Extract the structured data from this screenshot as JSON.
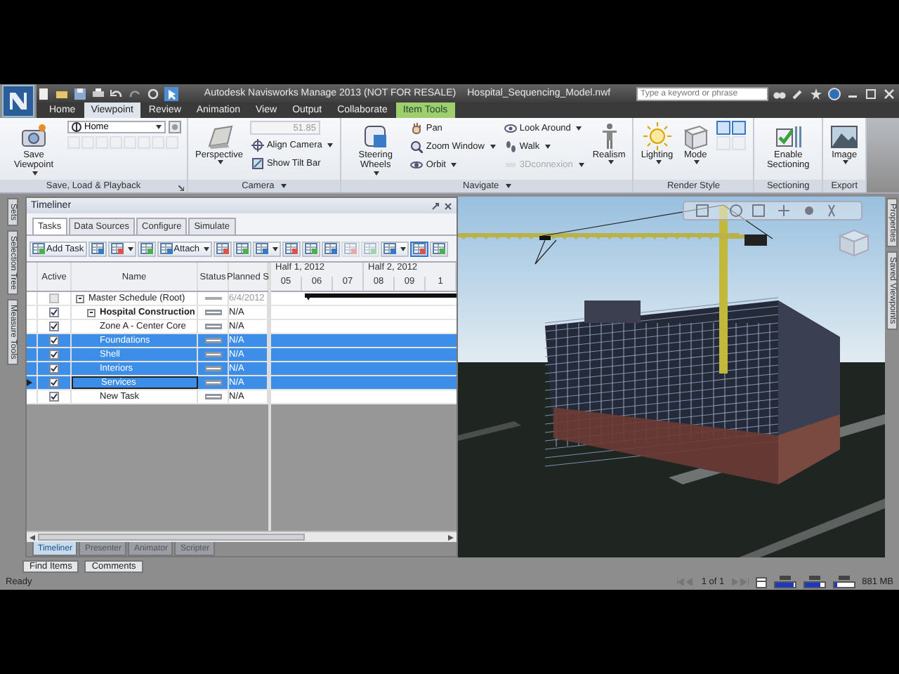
{
  "title_bar": {
    "title": "Autodesk Navisworks Manage 2013 (NOT FOR RESALE)",
    "file": "Hospital_Sequencing_Model.nwf",
    "search": {
      "placeholder": "Type a keyword or phrase"
    }
  },
  "ribbon_tabs": [
    {
      "label": "Home",
      "selected": false,
      "kind": "normal"
    },
    {
      "label": "Viewpoint",
      "selected": true,
      "kind": "normal"
    },
    {
      "label": "Review",
      "selected": false,
      "kind": "normal"
    },
    {
      "label": "Animation",
      "selected": false,
      "kind": "normal"
    },
    {
      "label": "View",
      "selected": false,
      "kind": "normal"
    },
    {
      "label": "Output",
      "selected": false,
      "kind": "normal"
    },
    {
      "label": "Collaborate",
      "selected": false,
      "kind": "normal"
    },
    {
      "label": "Item Tools",
      "selected": false,
      "kind": "contextual"
    }
  ],
  "ribbon_panels": [
    {
      "label": "Save, Load & Playback",
      "menu": false,
      "launcher": true,
      "columns": [
        [
          {
            "kind": "large",
            "label": "Save Viewpoint",
            "dropdown": true,
            "disabled": false
          }
        ],
        [
          {
            "kind": "select",
            "value": "Home"
          },
          {
            "kind": "buttons",
            "buttons": [
              {
                "selected": false,
                "disabled": true
              },
              {
                "selected": false,
                "disabled": true
              },
              {
                "selected": false,
                "disabled": true
              },
              {
                "selected": false,
                "disabled": true
              },
              {
                "selected": false,
                "disabled": true
              },
              {
                "selected": false,
                "disabled": true
              },
              {
                "selected": false,
                "disabled": true
              },
              {
                "selected": false,
                "disabled": true
              }
            ]
          }
        ]
      ]
    },
    {
      "label": "Camera",
      "menu": true,
      "launcher": false,
      "columns": [
        [
          {
            "kind": "large",
            "label": "Perspective",
            "dropdown": true,
            "disabled": false
          }
        ],
        [
          {
            "kind": "field",
            "value": "51.85",
            "disabled": true
          },
          {
            "kind": "small",
            "label": "Align Camera",
            "dropdown": true,
            "disabled": false
          },
          {
            "kind": "small",
            "label": "Show Tilt Bar",
            "dropdown": false,
            "disabled": false
          }
        ]
      ]
    },
    {
      "label": "Navigate",
      "menu": true,
      "launcher": false,
      "columns": [
        [
          {
            "kind": "large",
            "label": "Steering Wheels",
            "dropdown": true,
            "disabled": false
          }
        ],
        [
          {
            "kind": "small",
            "label": "Pan",
            "dropdown": false,
            "disabled": false
          },
          {
            "kind": "small",
            "label": "Zoom Window",
            "dropdown": true,
            "disabled": false
          },
          {
            "kind": "small",
            "label": "Orbit",
            "dropdown": true,
            "disabled": false
          }
        ],
        [
          {
            "kind": "small",
            "label": "Look Around",
            "dropdown": true,
            "disabled": false
          },
          {
            "kind": "small",
            "label": "Walk",
            "dropdown": true,
            "disabled": false
          },
          {
            "kind": "small",
            "label": "3Dconnexion",
            "dropdown": true,
            "disabled": true
          }
        ],
        [
          {
            "kind": "large",
            "label": "Realism",
            "dropdown": true,
            "disabled": false
          }
        ]
      ]
    },
    {
      "label": "Render Style",
      "menu": false,
      "launcher": false,
      "columns": [
        [
          {
            "kind": "large",
            "label": "Lighting",
            "dropdown": true,
            "disabled": false
          }
        ],
        [
          {
            "kind": "large",
            "label": "Mode",
            "dropdown": true,
            "disabled": false
          }
        ],
        [
          {
            "kind": "buttons",
            "buttons": [
              {
                "selected": true,
                "disabled": false
              },
              {
                "selected": true,
                "disabled": false
              },
              {
                "selected": false,
                "disabled": true
              },
              {
                "selected": false,
                "disabled": true
              }
            ]
          }
        ]
      ]
    },
    {
      "label": "Sectioning",
      "menu": false,
      "launcher": false,
      "columns": [
        [
          {
            "kind": "large",
            "label": "Enable Sectioning",
            "dropdown": false,
            "disabled": false
          }
        ]
      ]
    },
    {
      "label": "Export",
      "menu": false,
      "launcher": false,
      "columns": [
        [
          {
            "kind": "large",
            "label": "Image",
            "dropdown": true,
            "disabled": false
          }
        ]
      ]
    }
  ],
  "left_tabs": [
    "Sets",
    "Selection Tree",
    "Measure Tools"
  ],
  "timeliner": {
    "title": "Timeliner",
    "tabs": [
      {
        "label": "Tasks",
        "selected": true
      },
      {
        "label": "Data Sources",
        "selected": false
      },
      {
        "label": "Configure",
        "selected": false
      },
      {
        "label": "Simulate",
        "selected": false
      }
    ],
    "toolbar": [
      {
        "kind": "text",
        "label": "Add Task",
        "dropdown": false,
        "selected": false,
        "disabled": false
      },
      {
        "kind": "icon",
        "dropdown": false,
        "selected": false,
        "disabled": false
      },
      {
        "kind": "icon",
        "dropdown": true,
        "selected": false,
        "disabled": false
      },
      {
        "kind": "icon",
        "dropdown": false,
        "selected": false,
        "disabled": false
      },
      {
        "kind": "text",
        "label": "Attach",
        "dropdown": true,
        "selected": false,
        "disabled": false
      },
      {
        "kind": "icon",
        "dropdown": false,
        "selected": false,
        "disabled": false
      },
      {
        "kind": "icon",
        "dropdown": false,
        "selected": false,
        "disabled": false
      },
      {
        "kind": "icon",
        "dropdown": true,
        "selected": false,
        "disabled": false
      },
      {
        "kind": "icon",
        "dropdown": false,
        "selected": false,
        "disabled": false
      },
      {
        "kind": "icon",
        "dropdown": false,
        "selected": false,
        "disabled": false
      },
      {
        "kind": "icon",
        "dropdown": false,
        "selected": false,
        "disabled": false
      },
      {
        "kind": "icon",
        "dropdown": false,
        "selected": false,
        "disabled": true
      },
      {
        "kind": "icon",
        "dropdown": false,
        "selected": false,
        "disabled": true
      },
      {
        "kind": "icon",
        "dropdown": true,
        "selected": false,
        "disabled": false
      },
      {
        "kind": "icon",
        "dropdown": false,
        "selected": true,
        "disabled": false
      },
      {
        "kind": "icon",
        "dropdown": false,
        "selected": false,
        "disabled": false
      }
    ],
    "columns": [
      "Active",
      "Name",
      "Status",
      "Planned S"
    ],
    "periods": [
      "Half 1, 2012",
      "Half 2, 2012"
    ],
    "months": [
      "05",
      "06",
      "07",
      "08",
      "09",
      "1"
    ],
    "tasks": [
      {
        "name": "Master Schedule (Root)",
        "kind": "root",
        "active": false,
        "selected": false,
        "current": false,
        "expanded": true,
        "planned_start": "6/4/2012",
        "children": [
          {
            "name": "Hospital Construction",
            "kind": "summary",
            "active": true,
            "selected": false,
            "current": false,
            "expanded": true,
            "planned_start": "N/A",
            "children": [
              {
                "name": "Zone A - Center Core",
                "kind": "task",
                "active": true,
                "selected": false,
                "current": false,
                "planned_start": "N/A"
              },
              {
                "name": "Foundations",
                "kind": "task",
                "active": true,
                "selected": true,
                "current": false,
                "planned_start": "N/A"
              },
              {
                "name": "Shell",
                "kind": "task",
                "active": true,
                "selected": true,
                "current": false,
                "planned_start": "N/A"
              },
              {
                "name": "Interiors",
                "kind": "task",
                "active": true,
                "selected": true,
                "current": false,
                "planned_start": "N/A"
              },
              {
                "name": "Services",
                "kind": "task",
                "active": true,
                "selected": true,
                "current": true,
                "planned_start": "N/A"
              },
              {
                "name": "New Task",
                "kind": "task",
                "active": true,
                "selected": false,
                "current": false,
                "planned_start": "N/A"
              }
            ]
          }
        ]
      }
    ],
    "bottom_tabs": [
      {
        "label": "Timeliner",
        "selected": true
      },
      {
        "label": "Presenter",
        "selected": false
      },
      {
        "label": "Animator",
        "selected": false
      },
      {
        "label": "Scripter",
        "selected": false
      }
    ]
  },
  "right_tabs": [
    "Properties",
    "Saved Viewpoints"
  ],
  "bottom_buttons": [
    "Find Items",
    "Comments"
  ],
  "status_bar": {
    "text": "Ready",
    "page": "1 of 1",
    "memory": "881 MB",
    "meters": [
      {
        "level": 0.95
      },
      {
        "level": 0.85
      },
      {
        "level": 0.2
      }
    ]
  }
}
